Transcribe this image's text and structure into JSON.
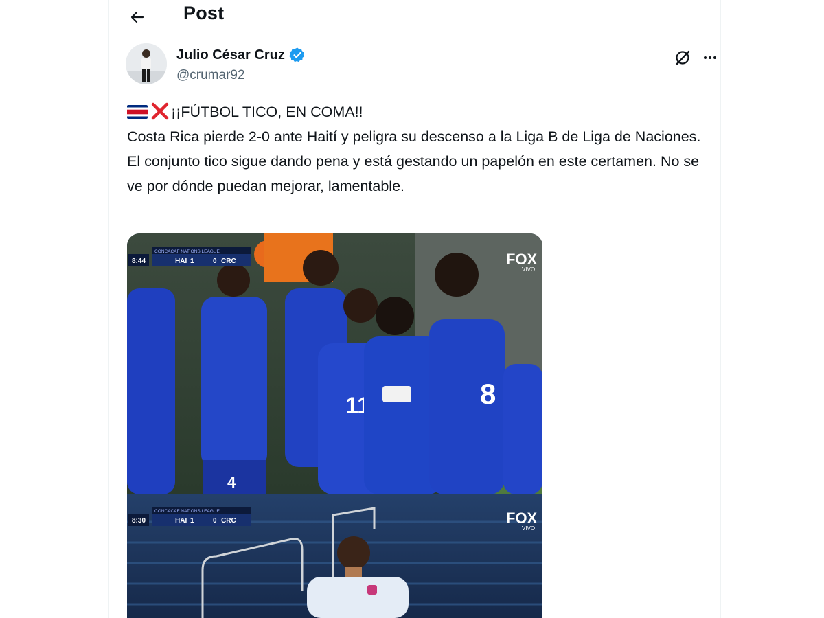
{
  "header": {
    "title": "Post"
  },
  "author": {
    "display_name": "Julio César Cruz",
    "handle": "@crumar92",
    "verified": true
  },
  "post": {
    "headline": "¡¡FÚTBOL TICO, EN COMA!!",
    "body": "Costa Rica pierde 2-0 ante Haití y peligra su descenso a la Liga B de Liga de Naciones. El conjunto tico sigue dando pena y está gestando un papelón en este certamen. No se ve por dónde puedan mejorar, lamentable.",
    "emojis": [
      "costa-rica-flag",
      "cross-mark"
    ]
  },
  "media": [
    {
      "description": "Haiti players celebrating",
      "scoreboard": {
        "clock": "8:44",
        "league": "CONCACAF NATIONS LEAGUE",
        "home": "HAI",
        "home_score": "1",
        "away_score": "0",
        "away": "CRC"
      },
      "broadcaster": "FOX",
      "broadcaster_sub": "VIVO"
    },
    {
      "description": "Costa Rica player looking down",
      "scoreboard": {
        "clock": "8:30",
        "league": "CONCACAF NATIONS LEAGUE",
        "home": "HAI",
        "home_score": "1",
        "away_score": "0",
        "away": "CRC"
      },
      "broadcaster": "FOX",
      "broadcaster_sub": "VIVO"
    }
  ],
  "colors": {
    "accent": "#1d9bf0",
    "text_primary": "#0f1419",
    "text_secondary": "#536471",
    "haiti_blue": "#1f3fbf",
    "haiti_red": "#c8102e"
  },
  "icons": [
    "back-arrow-icon",
    "verified-badge-icon",
    "grok-icon",
    "more-icon"
  ]
}
